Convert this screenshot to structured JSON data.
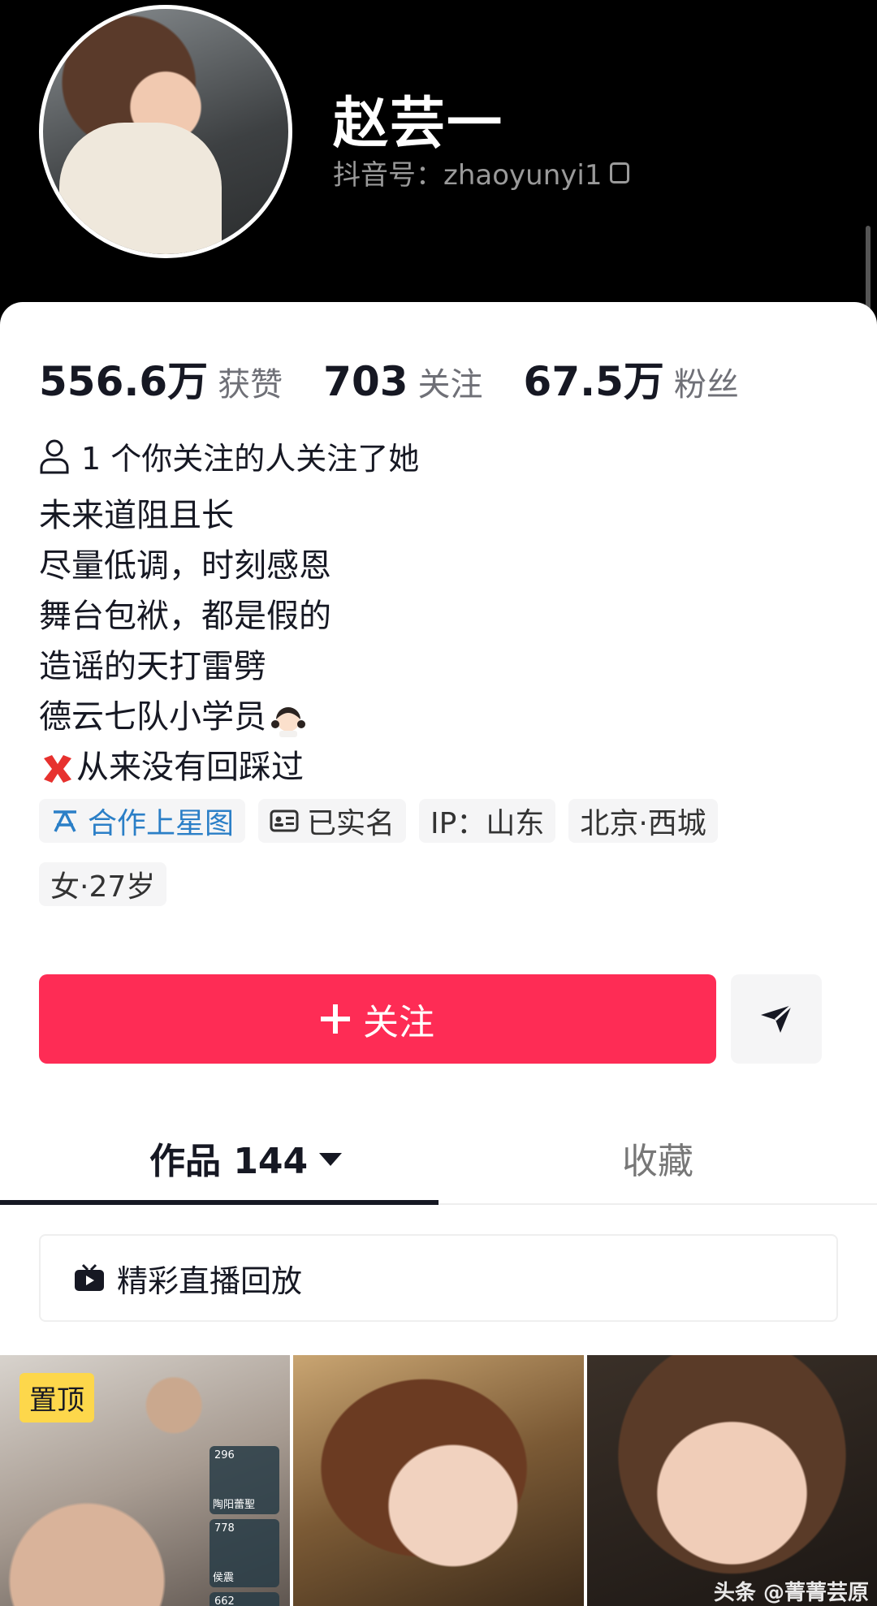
{
  "profile": {
    "name": "赵芸一",
    "douyin_id": "抖音号：zhaoyunyi1"
  },
  "stats": [
    {
      "value": "556.6万",
      "label": "获赞"
    },
    {
      "value": "703",
      "label": "关注"
    },
    {
      "value": "67.5万",
      "label": "粉丝"
    }
  ],
  "mutual_follow": "1 个你关注的人关注了她",
  "bio": [
    "未来道阻且长",
    "尽量低调，时刻感恩",
    "舞台包袱，都是假的",
    "造谣的天打雷劈",
    "德云七队小学员",
    "从来没有回踩过"
  ],
  "tags": {
    "xingtu": "合作上星图",
    "verified": "已实名",
    "ip": "IP：山东",
    "location": "北京·西城",
    "gender_age": "女·27岁"
  },
  "actions": {
    "follow": "关注"
  },
  "tabs": {
    "works": "作品 144",
    "favorites": "收藏"
  },
  "replay": "精彩直播回放",
  "grid": {
    "pin_label": "置顶",
    "live_items": [
      {
        "count": "296",
        "name": "陶阳蕾聖"
      },
      {
        "count": "778",
        "name": "侯震"
      },
      {
        "count": "662",
        "name": ""
      }
    ],
    "watermark": "头条 @菁菁芸原"
  },
  "colors": {
    "accent": "#fe2c55",
    "link_blue": "#2b7fc7",
    "pin_yellow": "#fdd74b"
  }
}
